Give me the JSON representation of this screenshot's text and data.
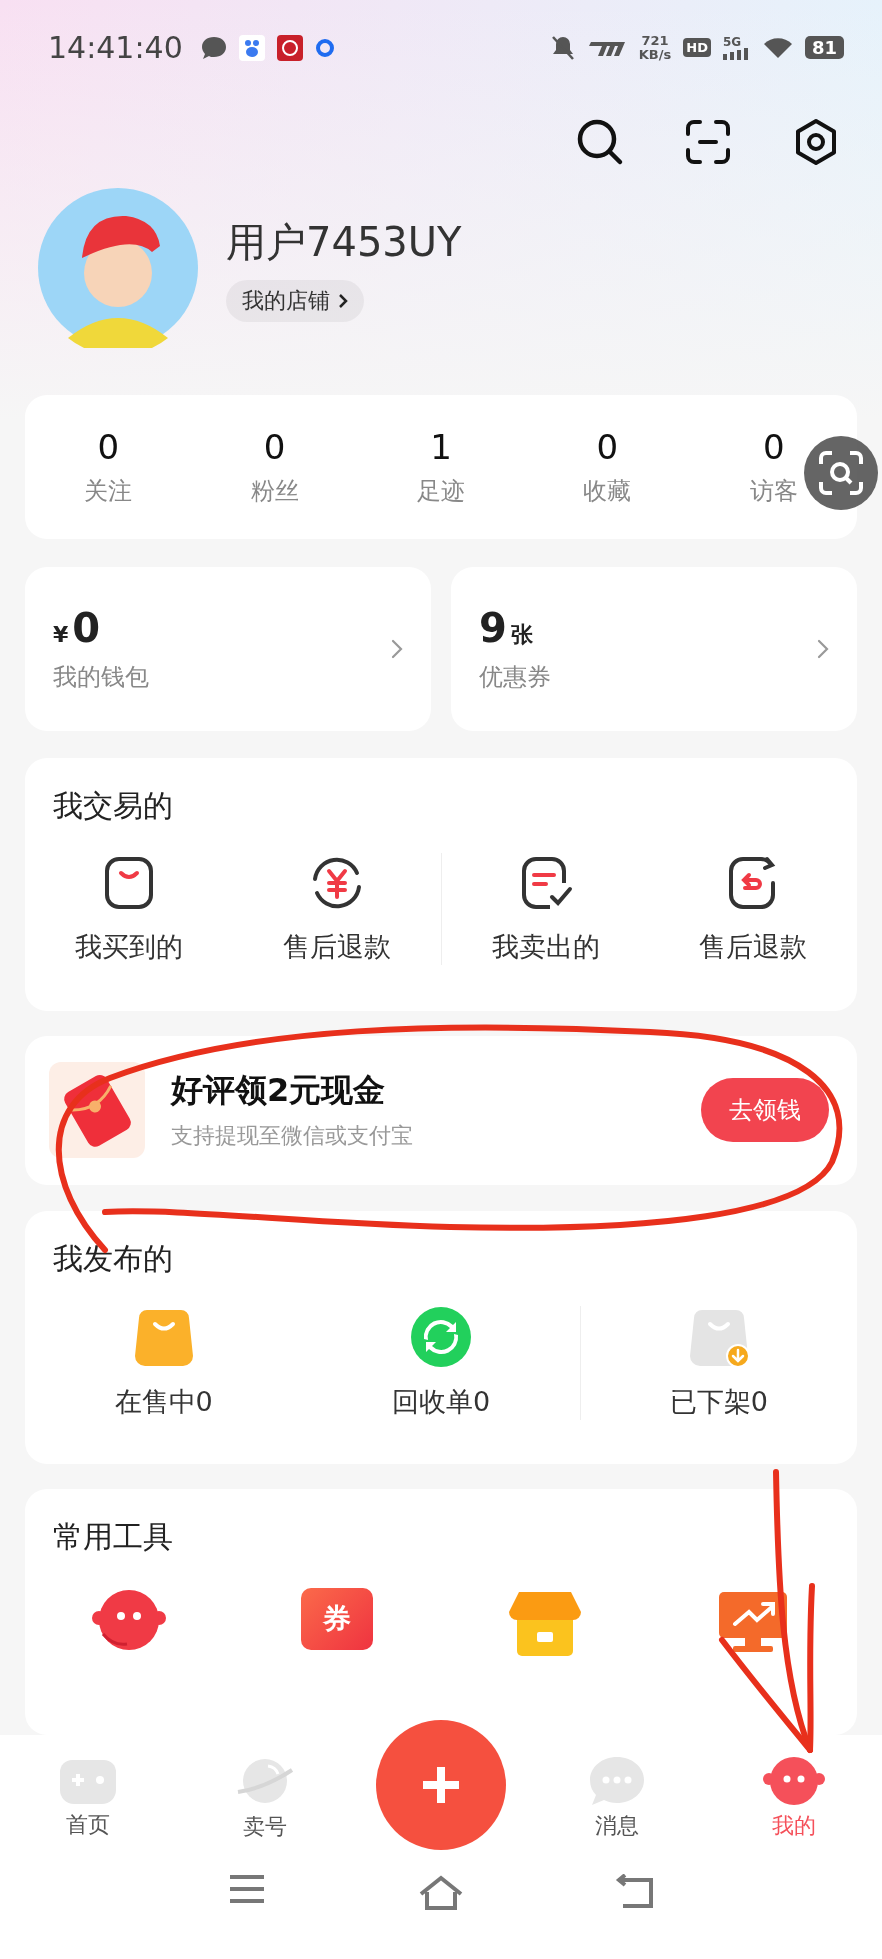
{
  "status_bar": {
    "time": "14:41:40",
    "speed": "721",
    "speed_unit": "KB/s",
    "hd": "HD",
    "network": "5G",
    "battery": "81"
  },
  "profile": {
    "username": "用户7453UY",
    "shop_link": "我的店铺"
  },
  "stats": [
    {
      "value": "0",
      "label": "关注"
    },
    {
      "value": "0",
      "label": "粉丝"
    },
    {
      "value": "1",
      "label": "足迹"
    },
    {
      "value": "0",
      "label": "收藏"
    },
    {
      "value": "0",
      "label": "访客"
    }
  ],
  "wallet": {
    "currency": "¥",
    "amount": "0",
    "label": "我的钱包"
  },
  "coupons": {
    "count": "9",
    "unit": "张",
    "label": "优惠券"
  },
  "trades": {
    "title": "我交易的",
    "items": [
      {
        "kind": "bag",
        "label": "我买到的"
      },
      {
        "kind": "refund",
        "label": "售后退款"
      },
      {
        "kind": "sold",
        "label": "我卖出的"
      },
      {
        "kind": "return",
        "label": "售后退款"
      }
    ]
  },
  "promo": {
    "title": "好评领2元现金",
    "subtitle": "支持提现至微信或支付宝",
    "button": "去领钱"
  },
  "published": {
    "title": "我发布的",
    "items": [
      {
        "kind": "on-sale",
        "label": "在售中0"
      },
      {
        "kind": "recycle",
        "label": "回收单0"
      },
      {
        "kind": "delisted",
        "label": "已下架0"
      }
    ]
  },
  "tools": {
    "title": "常用工具",
    "items": [
      {
        "kind": "service"
      },
      {
        "kind": "coupon",
        "badge": "券"
      },
      {
        "kind": "shop"
      },
      {
        "kind": "screen"
      }
    ]
  },
  "nav": {
    "tabs": [
      {
        "kind": "home",
        "label": "首页",
        "selected": false
      },
      {
        "kind": "sell",
        "label": "卖号",
        "selected": false
      },
      {
        "kind": "message",
        "label": "消息",
        "selected": false
      },
      {
        "kind": "me",
        "label": "我的",
        "selected": true
      }
    ]
  },
  "annotations": {
    "circle": true,
    "arrow": true
  }
}
